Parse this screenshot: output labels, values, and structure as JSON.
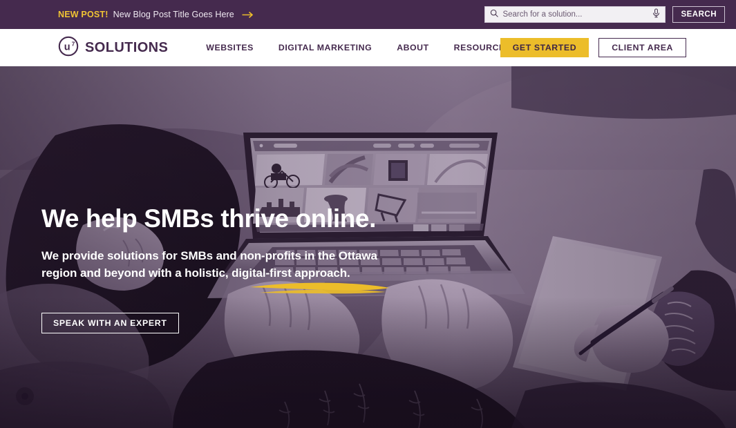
{
  "announcement": {
    "tag": "NEW POST!",
    "title": "New Blog Post Title Goes Here",
    "arrow_icon": "arrow-right-icon"
  },
  "search": {
    "placeholder": "Search for a solution...",
    "value": "",
    "search_icon": "search-icon",
    "mic_icon": "microphone-icon",
    "button_label": "SEARCH"
  },
  "brand": {
    "mark": "u7",
    "name": "SOLUTIONS"
  },
  "nav": {
    "links": [
      {
        "label": "WEBSITES"
      },
      {
        "label": "DIGITAL MARKETING"
      },
      {
        "label": "ABOUT"
      },
      {
        "label": "RESOURCES"
      }
    ],
    "get_started_label": "GET STARTED",
    "client_area_label": "CLIENT AREA"
  },
  "hero": {
    "title": "We help SMBs thrive online.",
    "subtitle_line1": "We provide solutions for SMBs and non-profits in the Ottawa",
    "subtitle_line2": "region and beyond with a holistic, digital-first approach.",
    "cta_label": "SPEAK WITH AN EXPERT"
  },
  "colors": {
    "brand_purple": "#452a4e",
    "accent_gold": "#ecbd2a",
    "announce_gold": "#f0c433",
    "white": "#ffffff"
  }
}
